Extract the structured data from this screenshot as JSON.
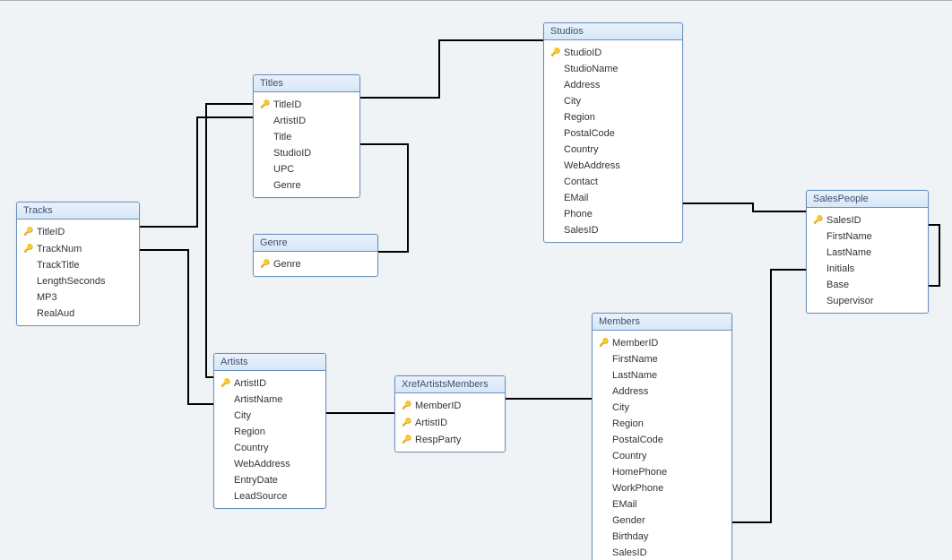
{
  "tables": {
    "tracks": {
      "name": "Tracks",
      "columns": [
        {
          "name": "TitleID",
          "pk": true
        },
        {
          "name": "TrackNum",
          "pk": true
        },
        {
          "name": "TrackTitle",
          "pk": false
        },
        {
          "name": "LengthSeconds",
          "pk": false
        },
        {
          "name": "MP3",
          "pk": false
        },
        {
          "name": "RealAud",
          "pk": false
        }
      ]
    },
    "titles": {
      "name": "Titles",
      "columns": [
        {
          "name": "TitleID",
          "pk": true
        },
        {
          "name": "ArtistID",
          "pk": false
        },
        {
          "name": "Title",
          "pk": false
        },
        {
          "name": "StudioID",
          "pk": false
        },
        {
          "name": "UPC",
          "pk": false
        },
        {
          "name": "Genre",
          "pk": false
        }
      ]
    },
    "genre": {
      "name": "Genre",
      "columns": [
        {
          "name": "Genre",
          "pk": true
        }
      ]
    },
    "studios": {
      "name": "Studios",
      "columns": [
        {
          "name": "StudioID",
          "pk": true
        },
        {
          "name": "StudioName",
          "pk": false
        },
        {
          "name": "Address",
          "pk": false
        },
        {
          "name": "City",
          "pk": false
        },
        {
          "name": "Region",
          "pk": false
        },
        {
          "name": "PostalCode",
          "pk": false
        },
        {
          "name": "Country",
          "pk": false
        },
        {
          "name": "WebAddress",
          "pk": false
        },
        {
          "name": "Contact",
          "pk": false
        },
        {
          "name": "EMail",
          "pk": false
        },
        {
          "name": "Phone",
          "pk": false
        },
        {
          "name": "SalesID",
          "pk": false
        }
      ]
    },
    "salespeople": {
      "name": "SalesPeople",
      "columns": [
        {
          "name": "SalesID",
          "pk": true
        },
        {
          "name": "FirstName",
          "pk": false
        },
        {
          "name": "LastName",
          "pk": false
        },
        {
          "name": "Initials",
          "pk": false
        },
        {
          "name": "Base",
          "pk": false
        },
        {
          "name": "Supervisor",
          "pk": false
        }
      ]
    },
    "artists": {
      "name": "Artists",
      "columns": [
        {
          "name": "ArtistID",
          "pk": true
        },
        {
          "name": "ArtistName",
          "pk": false
        },
        {
          "name": "City",
          "pk": false
        },
        {
          "name": "Region",
          "pk": false
        },
        {
          "name": "Country",
          "pk": false
        },
        {
          "name": "WebAddress",
          "pk": false
        },
        {
          "name": "EntryDate",
          "pk": false
        },
        {
          "name": "LeadSource",
          "pk": false
        }
      ]
    },
    "xref": {
      "name": "XrefArtistsMembers",
      "columns": [
        {
          "name": "MemberID",
          "pk": true
        },
        {
          "name": "ArtistID",
          "pk": true
        },
        {
          "name": "RespParty",
          "pk": true
        }
      ]
    },
    "members": {
      "name": "Members",
      "columns": [
        {
          "name": "MemberID",
          "pk": true
        },
        {
          "name": "FirstName",
          "pk": false
        },
        {
          "name": "LastName",
          "pk": false
        },
        {
          "name": "Address",
          "pk": false
        },
        {
          "name": "City",
          "pk": false
        },
        {
          "name": "Region",
          "pk": false
        },
        {
          "name": "PostalCode",
          "pk": false
        },
        {
          "name": "Country",
          "pk": false
        },
        {
          "name": "HomePhone",
          "pk": false
        },
        {
          "name": "WorkPhone",
          "pk": false
        },
        {
          "name": "EMail",
          "pk": false
        },
        {
          "name": "Gender",
          "pk": false
        },
        {
          "name": "Birthday",
          "pk": false
        },
        {
          "name": "SalesID",
          "pk": false
        }
      ]
    }
  },
  "relationships": [
    {
      "from": "Tracks.TitleID",
      "to": "Titles.TitleID"
    },
    {
      "from": "Titles.StudioID",
      "to": "Studios.StudioID"
    },
    {
      "from": "Titles.Genre",
      "to": "Genre.Genre"
    },
    {
      "from": "Titles.ArtistID",
      "to": "Artists.ArtistID"
    },
    {
      "from": "XrefArtistsMembers.ArtistID",
      "to": "Artists.ArtistID"
    },
    {
      "from": "XrefArtistsMembers.MemberID",
      "to": "Members.MemberID"
    },
    {
      "from": "Members.SalesID",
      "to": "SalesPeople.SalesID"
    },
    {
      "from": "Studios.SalesID",
      "to": "SalesPeople.SalesID"
    },
    {
      "from": "SalesPeople.Supervisor",
      "to": "SalesPeople.SalesID"
    }
  ]
}
